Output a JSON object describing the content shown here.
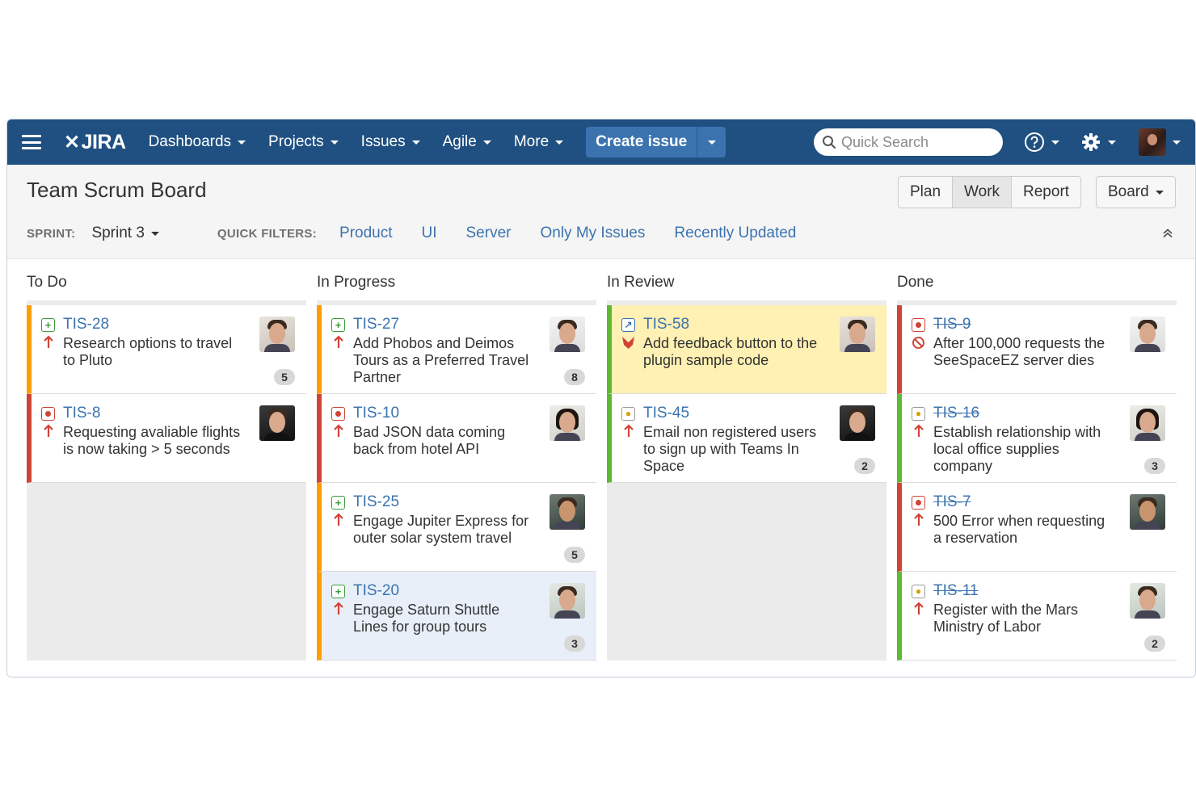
{
  "nav": {
    "logo": "JIRA",
    "items": [
      {
        "label": "Dashboards"
      },
      {
        "label": "Projects"
      },
      {
        "label": "Issues"
      },
      {
        "label": "Agile"
      },
      {
        "label": "More"
      }
    ],
    "create_label": "Create issue",
    "search_placeholder": "Quick Search"
  },
  "header": {
    "title": "Team Scrum Board",
    "modes": [
      {
        "label": "Plan",
        "active": false
      },
      {
        "label": "Work",
        "active": true
      },
      {
        "label": "Report",
        "active": false
      }
    ],
    "board_label": "Board",
    "sprint_label": "SPRINT:",
    "sprint_value": "Sprint 3",
    "quick_filters_label": "QUICK FILTERS:",
    "quick_filters": [
      "Product",
      "UI",
      "Server",
      "Only My Issues",
      "Recently Updated"
    ]
  },
  "columns": [
    {
      "title": "To Do",
      "cards": [
        {
          "key": "TIS-28",
          "type": "story-icon",
          "priority": "major-priority-icon",
          "summary": "Research options to travel to Pluto",
          "points": "5",
          "accent": "#ff9d00"
        },
        {
          "key": "TIS-8",
          "type": "bug-icon",
          "priority": "major-priority-icon",
          "summary": "Requesting avaliable flights is now taking > 5 seconds",
          "points": "",
          "accent": "#d04437"
        }
      ]
    },
    {
      "title": "In Progress",
      "cards": [
        {
          "key": "TIS-27",
          "type": "story-icon",
          "priority": "major-priority-icon",
          "summary": "Add Phobos and Deimos Tours as a Preferred Travel Partner",
          "points": "8",
          "accent": "#ff9d00"
        },
        {
          "key": "TIS-10",
          "type": "bug-icon",
          "priority": "major-priority-icon",
          "summary": "Bad JSON data coming back from hotel API",
          "points": "",
          "accent": "#d04437"
        },
        {
          "key": "TIS-25",
          "type": "story-icon",
          "priority": "major-priority-icon",
          "summary": "Engage Jupiter Express for outer solar system travel",
          "points": "5",
          "accent": "#ff9d00"
        },
        {
          "key": "TIS-20",
          "type": "story-icon",
          "priority": "major-priority-icon",
          "summary": "Engage Saturn Shuttle Lines for group tours",
          "points": "3",
          "accent": "#ff9d00"
        }
      ]
    },
    {
      "title": "In Review",
      "cards": [
        {
          "key": "TIS-58",
          "type": "improvement-icon",
          "priority": "flag-icon",
          "summary": "Add feedback button to the plugin sample code",
          "points": "",
          "accent": "#5fb832"
        },
        {
          "key": "TIS-45",
          "type": "idea-icon",
          "priority": "major-priority-icon",
          "summary": "Email non registered users to sign up with Teams In Space",
          "points": "2",
          "accent": "#5fb832"
        }
      ]
    },
    {
      "title": "Done",
      "cards": [
        {
          "key": "TIS-9",
          "type": "bug-icon",
          "priority": "blocker-priority-icon",
          "summary": "After 100,000 requests the SeeSpaceEZ server dies",
          "points": "",
          "accent": "#d04437"
        },
        {
          "key": "TIS-16",
          "type": "idea-icon",
          "priority": "major-priority-icon",
          "summary": "Establish relationship with local office supplies company",
          "points": "3",
          "accent": "#5fb832"
        },
        {
          "key": "TIS-7",
          "type": "bug-icon",
          "priority": "major-priority-icon",
          "summary": "500 Error when requesting a reservation",
          "points": "",
          "accent": "#d04437"
        },
        {
          "key": "TIS-11",
          "type": "idea-icon",
          "priority": "major-priority-icon",
          "summary": "Register with the Mars Ministry of Labor",
          "points": "2",
          "accent": "#5fb832"
        }
      ]
    }
  ]
}
